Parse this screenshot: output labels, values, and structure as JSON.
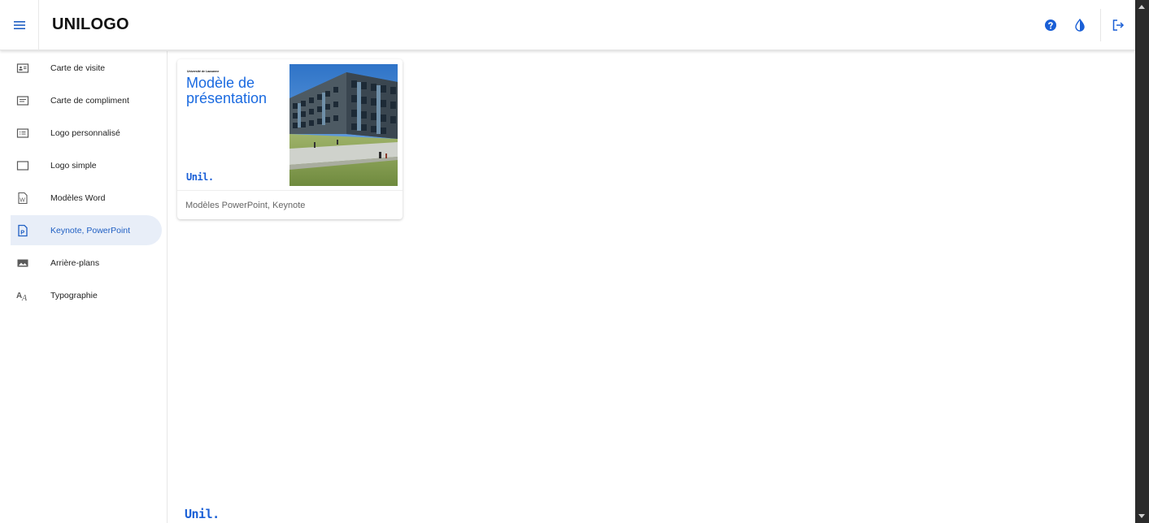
{
  "header": {
    "title": "UNILOGO",
    "menu_icon": "hamburger-menu-icon",
    "actions": [
      {
        "icon": "help-icon"
      },
      {
        "icon": "contrast-icon"
      },
      {
        "icon": "logout-icon"
      }
    ]
  },
  "sidebar": {
    "items": [
      {
        "label": "Carte de visite",
        "icon": "contact-card-icon"
      },
      {
        "label": "Carte de compliment",
        "icon": "note-icon"
      },
      {
        "label": "Logo personnalisé",
        "icon": "custom-logo-icon"
      },
      {
        "label": "Logo simple",
        "icon": "rectangle-icon"
      },
      {
        "label": "Modèles Word",
        "icon": "word-document-icon"
      },
      {
        "label": "Keynote, PowerPoint",
        "icon": "powerpoint-document-icon",
        "active": true
      },
      {
        "label": "Arrière-plans",
        "icon": "image-icon"
      },
      {
        "label": "Typographie",
        "icon": "typography-icon"
      }
    ]
  },
  "card": {
    "thumb_org": "Université de Lausanne",
    "thumb_title": "Modèle de présentation",
    "thumb_brand": "Unil.",
    "caption": "Modèles PowerPoint, Keynote"
  },
  "footer": {
    "brand": "Unil."
  },
  "colors": {
    "accent": "#1f5fc3",
    "active_bg": "#e8eef8",
    "brand_blue": "#1a5fd6"
  }
}
